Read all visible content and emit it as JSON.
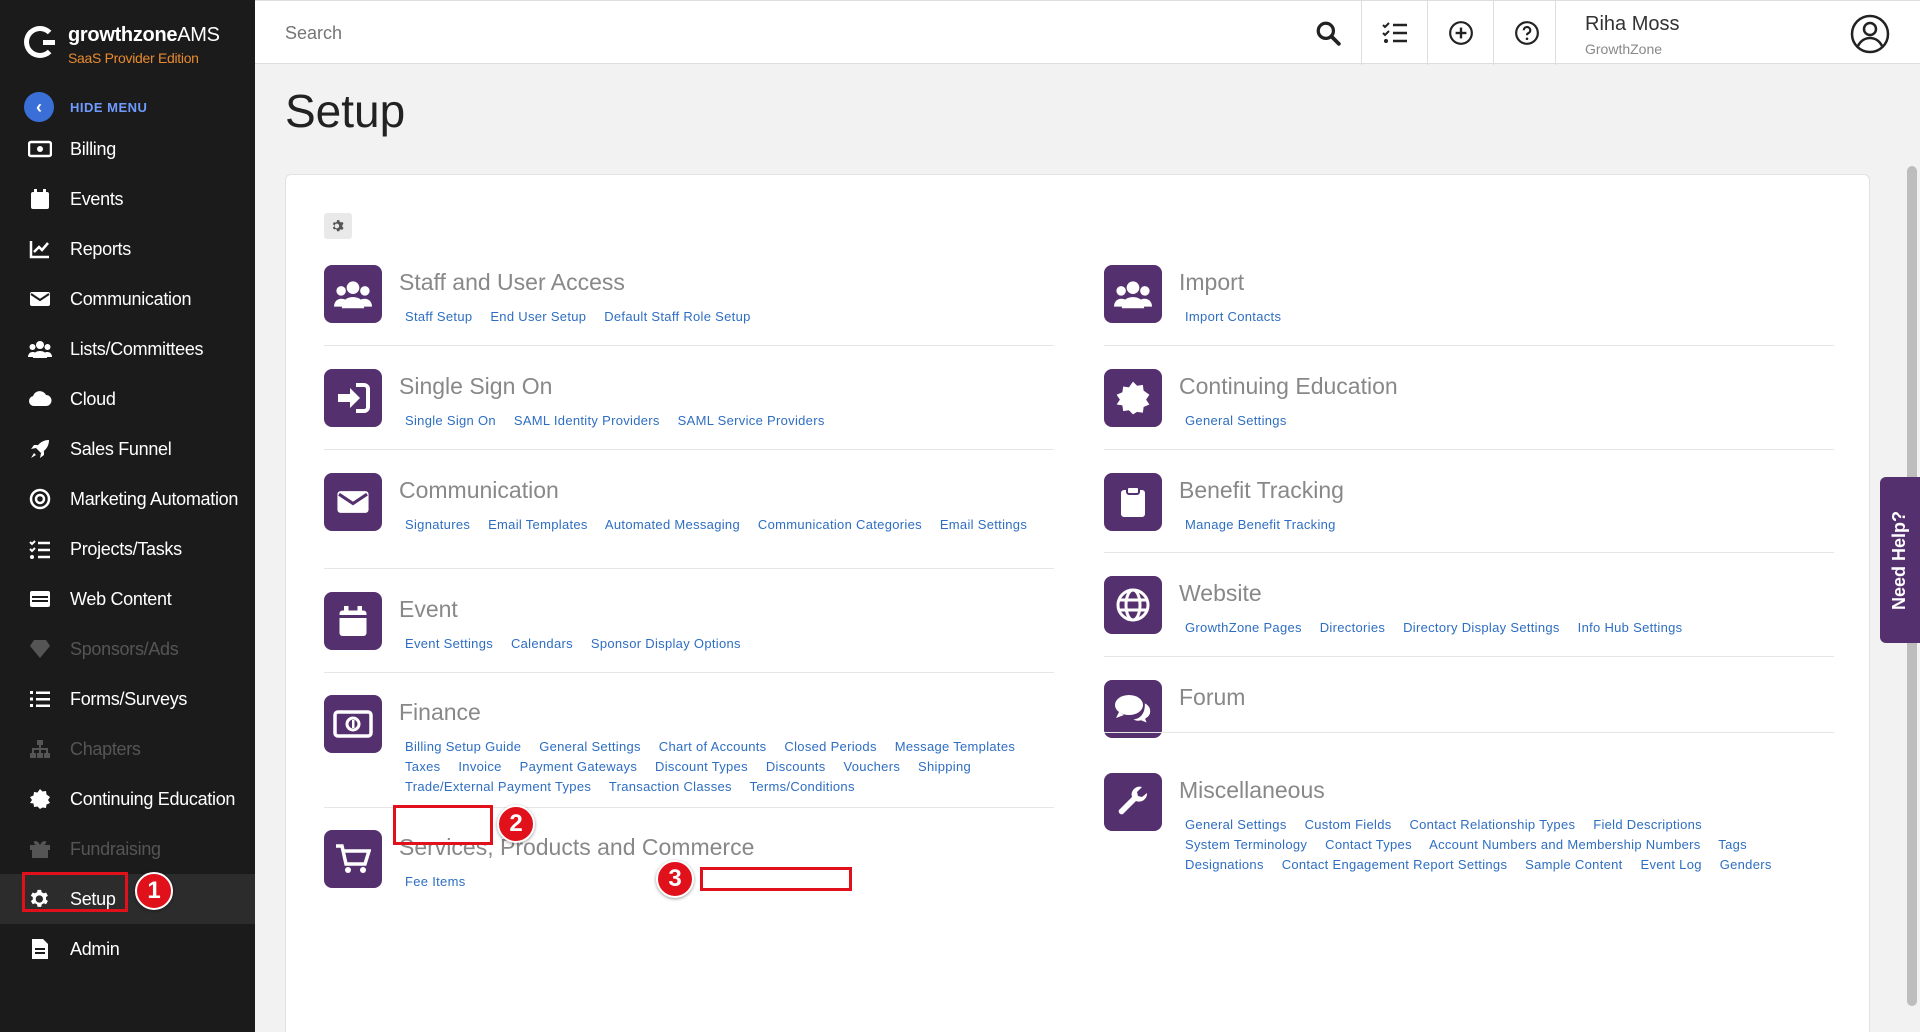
{
  "app": {
    "logo_title_bold": "growthzone",
    "logo_title_rest": "AMS",
    "logo_subtitle": "SaaS Provider Edition",
    "hide_menu": "HIDE MENU"
  },
  "sidebar": {
    "items": [
      {
        "label": "Billing",
        "icon": "billing-icon",
        "disabled": false
      },
      {
        "label": "Events",
        "icon": "calendar-icon",
        "disabled": false
      },
      {
        "label": "Reports",
        "icon": "chart-icon",
        "disabled": false
      },
      {
        "label": "Communication",
        "icon": "envelope-icon",
        "disabled": false
      },
      {
        "label": "Lists/Committees",
        "icon": "users-icon",
        "disabled": false
      },
      {
        "label": "Cloud",
        "icon": "cloud-icon",
        "disabled": false
      },
      {
        "label": "Sales Funnel",
        "icon": "rocket-icon",
        "disabled": false
      },
      {
        "label": "Marketing Automation",
        "icon": "target-icon",
        "disabled": false
      },
      {
        "label": "Projects/Tasks",
        "icon": "tasks-icon",
        "disabled": false
      },
      {
        "label": "Web Content",
        "icon": "web-icon",
        "disabled": false
      },
      {
        "label": "Sponsors/Ads",
        "icon": "gem-icon",
        "disabled": true
      },
      {
        "label": "Forms/Surveys",
        "icon": "list-icon",
        "disabled": false
      },
      {
        "label": "Chapters",
        "icon": "sitemap-icon",
        "disabled": true
      },
      {
        "label": "Continuing Education",
        "icon": "badge-icon",
        "disabled": false
      },
      {
        "label": "Fundraising",
        "icon": "gift-icon",
        "disabled": true
      },
      {
        "label": "Setup",
        "icon": "gear-icon",
        "disabled": false
      },
      {
        "label": "Admin",
        "icon": "document-icon",
        "disabled": false
      }
    ]
  },
  "header": {
    "search_placeholder": "Search",
    "user_name": "Riha Moss",
    "user_org": "GrowthZone"
  },
  "page": {
    "title": "Setup"
  },
  "annotations": {
    "step1": "1",
    "step2": "2",
    "step3": "3"
  },
  "need_help": "Need Help?",
  "sections_left": [
    {
      "title": "Staff and User Access",
      "icon": "users-icon",
      "links": [
        "Staff Setup",
        "End User Setup",
        "Default Staff Role Setup"
      ]
    },
    {
      "title": "Single Sign On",
      "icon": "sign-in-icon",
      "links": [
        "Single Sign On",
        "SAML Identity Providers",
        "SAML Service Providers"
      ]
    },
    {
      "title": "Communication",
      "icon": "envelope-icon",
      "links": [
        "Signatures",
        "Email Templates",
        "Automated Messaging",
        "Communication Categories",
        "Email Settings"
      ]
    },
    {
      "title": "Event",
      "icon": "calendar-icon",
      "links": [
        "Event Settings",
        "Calendars",
        "Sponsor Display Options"
      ]
    },
    {
      "title": "Finance",
      "icon": "money-icon",
      "links": [
        "Billing Setup Guide",
        "General Settings",
        "Chart of Accounts",
        "Closed Periods",
        "Message Templates",
        "Taxes",
        "Invoice",
        "Payment Gateways",
        "Discount Types",
        "Discounts",
        "Vouchers",
        "Shipping",
        "Trade/External Payment Types",
        "Transaction Classes",
        "Terms/Conditions"
      ]
    },
    {
      "title": "Services, Products and Commerce",
      "icon": "cart-icon",
      "links": [
        "Fee Items"
      ]
    }
  ],
  "sections_right": [
    {
      "title": "Import",
      "icon": "users-icon",
      "links": [
        "Import Contacts"
      ]
    },
    {
      "title": "Continuing Education",
      "icon": "badge-icon",
      "links": [
        "General Settings"
      ]
    },
    {
      "title": "Benefit Tracking",
      "icon": "clipboard-icon",
      "links": [
        "Manage Benefit Tracking"
      ]
    },
    {
      "title": "Website",
      "icon": "globe-icon",
      "links": [
        "GrowthZone Pages",
        "Directories",
        "Directory Display Settings",
        "Info Hub Settings"
      ]
    },
    {
      "title": "Forum",
      "icon": "comments-icon",
      "links": []
    },
    {
      "title": "Miscellaneous",
      "icon": "wrench-icon",
      "links": [
        "General Settings",
        "Custom Fields",
        "Contact Relationship Types",
        "Field Descriptions",
        "System Terminology",
        "Contact Types",
        "Account Numbers and Membership Numbers",
        "Tags",
        "Designations",
        "Contact Engagement Report Settings",
        "Sample Content",
        "Event Log",
        "Genders"
      ]
    }
  ]
}
